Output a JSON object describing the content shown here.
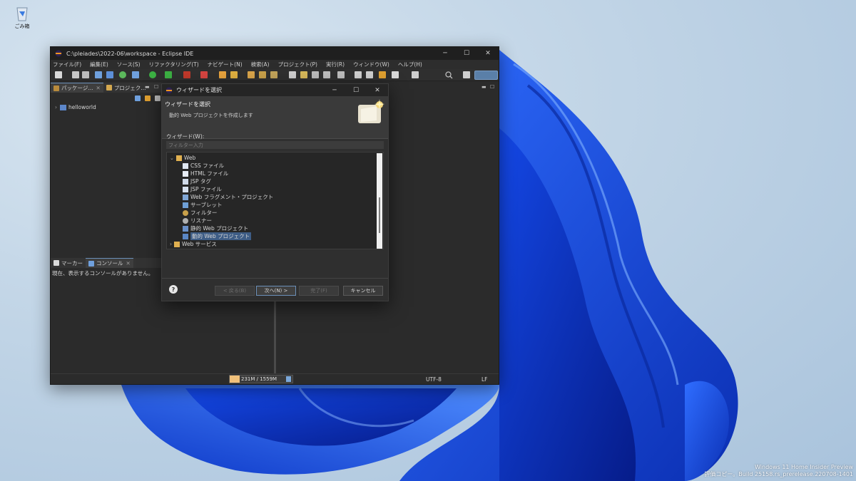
{
  "desktop": {
    "recycle_bin_label": "ごみ箱",
    "watermark_line1": "Windows 11 Home Insider Preview",
    "watermark_line2": "評価コピー。Build 25158.rs_prerelease.220708-1401"
  },
  "eclipse": {
    "title": "C:\\pleiades\\2022-06\\workspace - Eclipse IDE",
    "menu": [
      "ファイル(F)",
      "編集(E)",
      "ソース(S)",
      "リファクタリング(T)",
      "ナビゲート(N)",
      "検索(A)",
      "プロジェクト(P)",
      "実行(R)",
      "ウィンドウ(W)",
      "ヘルプ(H)"
    ],
    "left_tabs": [
      "パッケージ...",
      "プロジェク..."
    ],
    "project": "helloworld",
    "bottom_tabs": [
      "マーカー",
      "コンソール"
    ],
    "console_text": "現在、表示するコンソールがありません。",
    "status": {
      "heap": "231M / 1559M",
      "encoding": "UTF-8",
      "line_ending": "LF"
    }
  },
  "wizard": {
    "title": "ウィザードを選択",
    "header_title": "ウィザードを選択",
    "header_desc": "動的 Web プロジェクトを作成します",
    "field_label": "ウィザード(W):",
    "filter_placeholder": "フィルター入力",
    "tree": {
      "group": "Web",
      "items": [
        "CSS ファイル",
        "HTML ファイル",
        "JSP タグ",
        "JSP ファイル",
        "Web フラグメント・プロジェクト",
        "サーブレット",
        "フィルター",
        "リスナー",
        "静的 Web プロジェクト",
        "動的 Web プロジェクト"
      ],
      "selected_index": 9,
      "next_group": "Web サービス"
    },
    "buttons": {
      "back": "< 戻る(B)",
      "next": "次へ(N) >",
      "finish": "完了(F)",
      "cancel": "キャンセル"
    }
  }
}
